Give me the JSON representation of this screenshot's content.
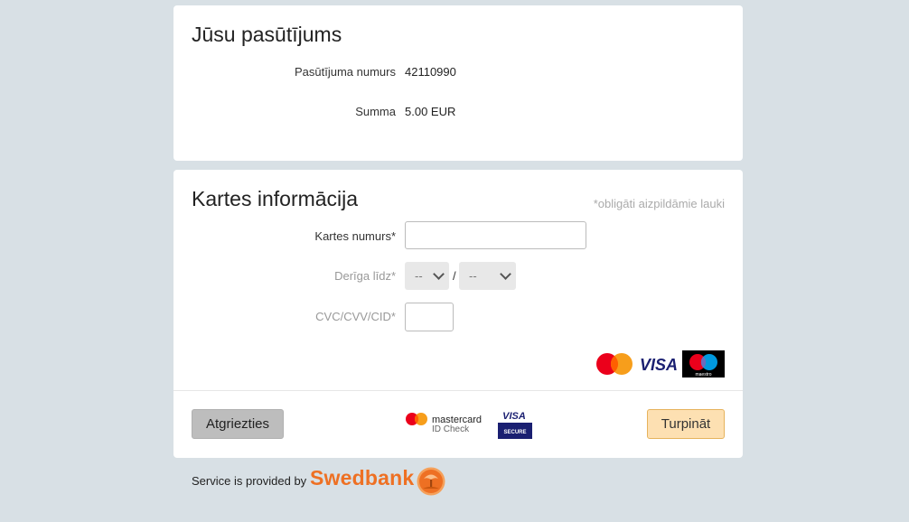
{
  "order": {
    "title": "Jūsu pasūtījums",
    "order_number_label": "Pasūtījuma numurs",
    "order_number": "42110990",
    "amount_label": "Summa",
    "amount": "5.00 EUR"
  },
  "card": {
    "title": "Kartes informācija",
    "required_note": "*obligāti aizpildāmie lauki",
    "card_number_label": "Kartes numurs*",
    "card_number_value": "",
    "expiry_label": "Derīga līdz*",
    "expiry_month": "--",
    "expiry_year": "--",
    "expiry_separator": "/",
    "cvc_label": "CVC/CVV/CID*",
    "cvc_value": "",
    "logos": [
      "mastercard-logo",
      "visa-logo",
      "maestro-logo"
    ]
  },
  "actions": {
    "back_label": "Atgriezties",
    "continue_label": "Turpināt",
    "secure_badges": {
      "mastercard_text_1": "mastercard",
      "mastercard_text_2": "ID Check",
      "visa_text": "VISA",
      "visa_secure_text": "SECURE"
    }
  },
  "footer": {
    "service_text": "Service is provided by",
    "brand": "Swedbank"
  },
  "colors": {
    "background": "#d8e0e5",
    "accent": "#ee7023",
    "continue_bg": "#fde0b2"
  }
}
